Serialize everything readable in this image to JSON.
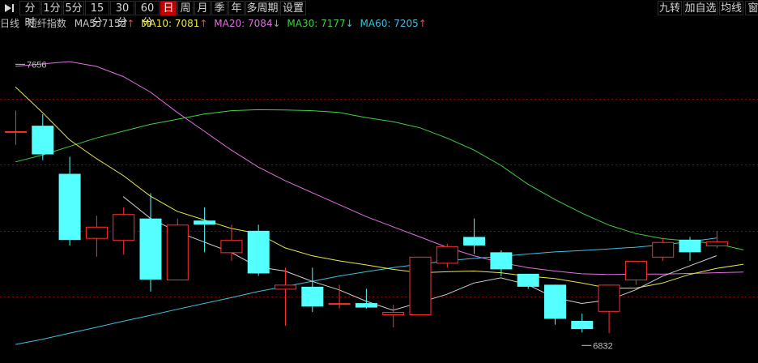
{
  "toolbar": {
    "left_icon": "play-end-icon",
    "periods": [
      "分时",
      "1分",
      "5分",
      "15分",
      "30分",
      "60分",
      "日",
      "周",
      "月",
      "季",
      "年",
      "多周期",
      "设置"
    ],
    "active_period": "日",
    "right": [
      "九转",
      "加自选",
      "均线",
      "窗"
    ]
  },
  "info": {
    "period": "日线",
    "name": "短纤指数",
    "ma5": "MA5: 7152",
    "ma5_arrow": "↑",
    "ma10": "MA10: 7081",
    "ma10_arrow": "↑",
    "ma20": "MA20: 7084",
    "ma20_arrow": "↓",
    "ma30": "MA30: 7177",
    "ma30_arrow": "↓",
    "ma60": "MA60: 7205",
    "ma60_arrow": "↑"
  },
  "colors": {
    "background": "#000000",
    "up": "#ff3030",
    "down": "#54ffff",
    "grid": "#8b0000",
    "ma5": "#d0d0d0",
    "ma10": "#e8e848",
    "ma20": "#e070e0",
    "ma30": "#40d040",
    "ma60": "#40c0e0"
  },
  "chart_data": {
    "type": "candlestick",
    "ylim": [
      6790,
      7740
    ],
    "grid": true,
    "high_label": "7656",
    "low_label": "6832",
    "candles": [
      {
        "o": 7460,
        "h": 7520,
        "l": 7420,
        "c": 7460
      },
      {
        "o": 7476,
        "h": 7510,
        "l": 7375,
        "c": 7392
      },
      {
        "o": 7335,
        "h": 7385,
        "l": 7125,
        "c": 7141
      },
      {
        "o": 7147,
        "h": 7212,
        "l": 7092,
        "c": 7180
      },
      {
        "o": 7141,
        "h": 7237,
        "l": 7098,
        "c": 7217
      },
      {
        "o": 7204,
        "h": 7278,
        "l": 6990,
        "c": 7025
      },
      {
        "o": 7025,
        "h": 7204,
        "l": 7025,
        "c": 7186
      },
      {
        "o": 7198,
        "h": 7237,
        "l": 7105,
        "c": 7186
      },
      {
        "o": 7105,
        "h": 7186,
        "l": 7080,
        "c": 7141
      },
      {
        "o": 7168,
        "h": 7186,
        "l": 7036,
        "c": 7043
      },
      {
        "o": 6998,
        "h": 7060,
        "l": 6890,
        "c": 7010
      },
      {
        "o": 7004,
        "h": 7060,
        "l": 6930,
        "c": 6946
      },
      {
        "o": 6956,
        "h": 7010,
        "l": 6940,
        "c": 6956
      },
      {
        "o": 6956,
        "h": 6998,
        "l": 6940,
        "c": 6943
      },
      {
        "o": 6923,
        "h": 6952,
        "l": 6885,
        "c": 6930
      },
      {
        "o": 6923,
        "h": 7092,
        "l": 6923,
        "c": 7092
      },
      {
        "o": 7074,
        "h": 7130,
        "l": 7060,
        "c": 7123
      },
      {
        "o": 7150,
        "h": 7204,
        "l": 7100,
        "c": 7125
      },
      {
        "o": 7105,
        "h": 7111,
        "l": 7035,
        "c": 7055
      },
      {
        "o": 7042,
        "h": 7042,
        "l": 6998,
        "c": 7004
      },
      {
        "o": 7010,
        "h": 7010,
        "l": 6893,
        "c": 6910
      },
      {
        "o": 6904,
        "h": 6925,
        "l": 6870,
        "c": 6880
      },
      {
        "o": 6933,
        "h": 7010,
        "l": 6868,
        "c": 7010
      },
      {
        "o": 7025,
        "h": 7080,
        "l": 7010,
        "c": 7080
      },
      {
        "o": 7092,
        "h": 7147,
        "l": 7080,
        "c": 7135
      },
      {
        "o": 7142,
        "h": 7150,
        "l": 7080,
        "c": 7105
      },
      {
        "o": 7125,
        "h": 7167,
        "l": 7117,
        "c": 7137
      }
    ],
    "ma5": [
      null,
      null,
      null,
      null,
      7268,
      7205,
      7165,
      7135,
      7105,
      7062,
      7050,
      7020,
      6995,
      6962,
      6935,
      6958,
      6982,
      7015,
      7030,
      7010,
      6972,
      6955,
      6965,
      6995,
      7035,
      7065,
      7095
    ],
    "ma10": [
      7590,
      7515,
      7435,
      7380,
      7330,
      7270,
      7225,
      7200,
      7175,
      7160,
      7118,
      7095,
      7080,
      7068,
      7055,
      7045,
      7048,
      7050,
      7045,
      7035,
      7028,
      7015,
      7000,
      7000,
      7015,
      7040,
      7058,
      7070
    ],
    "ma20": [
      7650,
      7657,
      7664,
      7650,
      7620,
      7575,
      7515,
      7460,
      7405,
      7355,
      7315,
      7280,
      7245,
      7210,
      7180,
      7150,
      7120,
      7095,
      7075,
      7060,
      7050,
      7042,
      7040,
      7041,
      7041,
      7043,
      7045,
      7047
    ],
    "ma30": [
      7370,
      7390,
      7415,
      7440,
      7460,
      7480,
      7495,
      7510,
      7520,
      7523,
      7522,
      7520,
      7515,
      7500,
      7488,
      7470,
      7440,
      7405,
      7360,
      7305,
      7260,
      7220,
      7185,
      7160,
      7145,
      7138,
      7130,
      7112
    ],
    "ma60": [
      6835,
      6850,
      6868,
      6885,
      6903,
      6920,
      6938,
      6955,
      6972,
      6990,
      7005,
      7020,
      7035,
      7048,
      7060,
      7070,
      7080,
      7087,
      7093,
      7100,
      7106,
      7110,
      7115,
      7120,
      7127,
      7136,
      7147
    ]
  }
}
